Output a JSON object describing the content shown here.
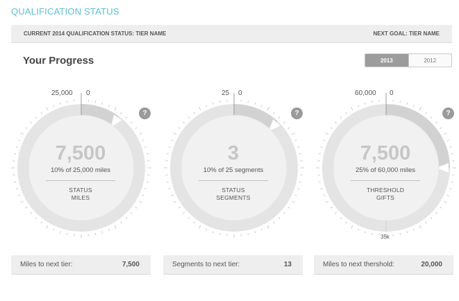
{
  "header": {
    "title": "QUALIFICATION STATUS",
    "current_status": "CURRENT 2014 QUALIFICATION STATUS: TIER NAME",
    "next_goal": "NEXT GOAL: TIER NAME"
  },
  "progress": {
    "heading": "Your Progress",
    "years": [
      "2013",
      "2012"
    ],
    "active_year": "2013"
  },
  "gauges": [
    {
      "value": "7,500",
      "subtitle": "10% of 25,000 miles",
      "caption_line1": "STATUS",
      "caption_line2": "MILES",
      "scale_max": "25,000",
      "scale_min": "0",
      "threshold_label": "",
      "progress_fraction": 0.1,
      "help_icon": "question-icon"
    },
    {
      "value": "3",
      "subtitle": "10% of 25 segments",
      "caption_line1": "STATUS",
      "caption_line2": "SEGMENTS",
      "scale_max": "25",
      "scale_min": "0",
      "threshold_label": "",
      "progress_fraction": 0.12,
      "help_icon": "question-icon"
    },
    {
      "value": "7,500",
      "subtitle": "25% of 60,000 miles",
      "caption_line1": "THRESHOLD",
      "caption_line2": "GIFTS",
      "scale_max": "60,000",
      "scale_min": "0",
      "threshold_label": "35k",
      "progress_fraction": 0.25,
      "help_icon": "question-icon"
    }
  ],
  "summary": [
    {
      "label": "Miles to next tier:",
      "value": "7,500"
    },
    {
      "label": "Segments to next tier:",
      "value": "13"
    },
    {
      "label": "Miles to next thershold:",
      "value": "20,000"
    }
  ],
  "colors": {
    "title_accent": "#5bbfcf",
    "ring_fill": "#e4e4e4",
    "ring_progress": "#d2d2d2",
    "inner_disc": "#f1f1f1",
    "tick": "#c8c8c8",
    "help_bg": "#9a9a9a"
  }
}
